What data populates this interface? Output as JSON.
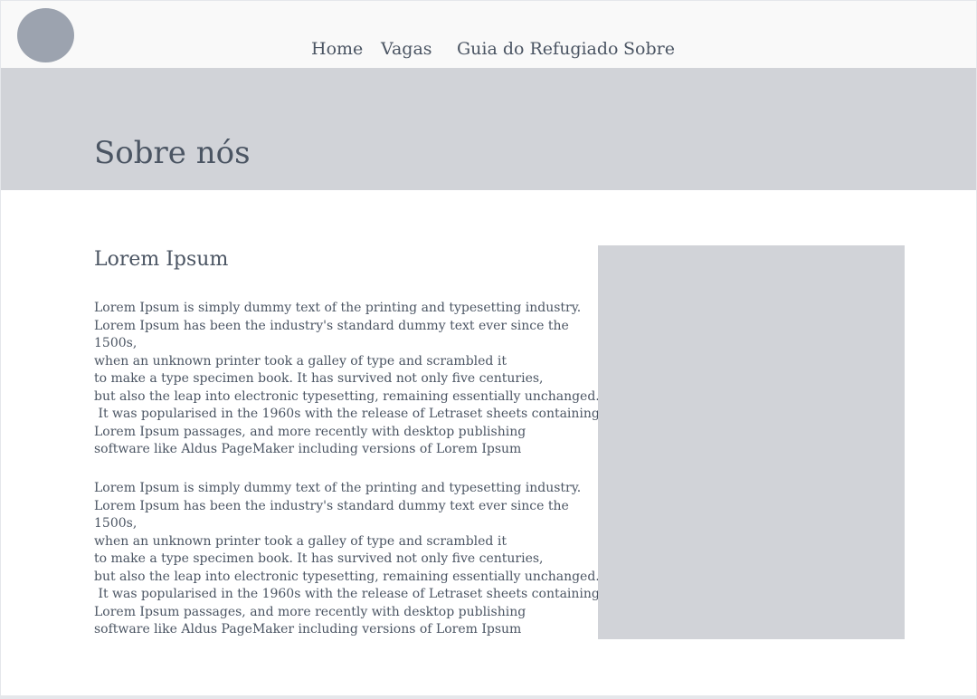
{
  "nav": {
    "links": [
      "Home",
      "Vagas",
      "Guia do Refugiado",
      "Sobre"
    ]
  },
  "hero": {
    "title": "Sobre nós"
  },
  "content": {
    "heading": "Lorem Ipsum",
    "paragraphs": [
      {
        "lines": [
          "Lorem Ipsum is simply dummy text of the printing and typesetting industry.",
          "Lorem Ipsum has been the industry's standard dummy text ever since the",
          "1500s,",
          "when an unknown printer took a galley of type and scrambled it",
          "to make a type specimen book. It has survived not only five centuries,",
          "but also the leap into electronic typesetting, remaining essentially unchanged.",
          " It was popularised in the 1960s with the release of Letraset sheets containing",
          "Lorem Ipsum passages, and more recently with desktop publishing",
          "software like Aldus PageMaker including versions of Lorem Ipsum"
        ]
      },
      {
        "lines": [
          "Lorem Ipsum is simply dummy text of the printing and typesetting industry.",
          "Lorem Ipsum has been the industry's standard dummy text ever since the",
          "1500s,",
          "when an unknown printer took a galley of type and scrambled it",
          "to make a type specimen book. It has survived not only five centuries,",
          "but also the leap into electronic typesetting, remaining essentially unchanged.",
          " It was popularised in the 1960s with the release of Letraset sheets containing",
          "Lorem Ipsum passages, and more recently with desktop publishing",
          "software like Aldus PageMaker including versions of Lorem Ipsum"
        ]
      }
    ]
  },
  "colors": {
    "navbar_bg": "#f9f9f9",
    "hero_bg": "#d1d3d8",
    "logo": "#9ca3af",
    "text": "#4b5563",
    "placeholder": "#d1d3d8"
  }
}
